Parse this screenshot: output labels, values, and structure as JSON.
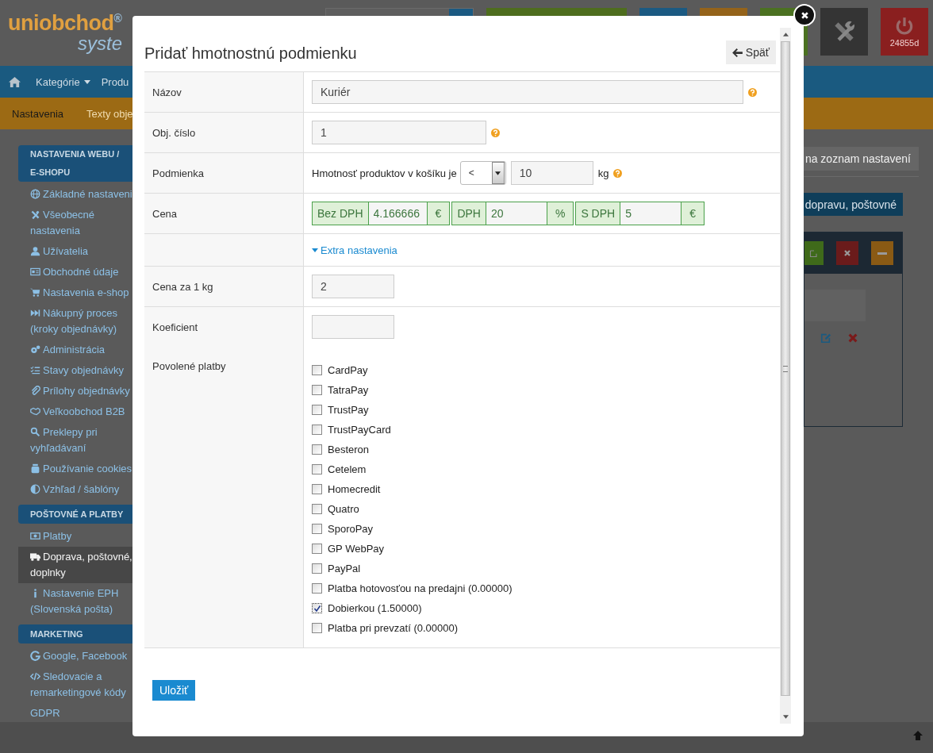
{
  "header": {
    "logo": {
      "text": "uniobchod",
      "mark": "®",
      "subtitle": "syste"
    },
    "toolbar": [
      {
        "kind": "search"
      },
      {
        "kind": "plain",
        "color": "#4e6d1e"
      },
      {
        "kind": "plain",
        "color": "#1b5a82"
      },
      {
        "kind": "plain",
        "color": "#94631a"
      },
      {
        "kind": "plain",
        "color": "#4b7121"
      },
      {
        "kind": "tools",
        "color": "#343434"
      },
      {
        "kind": "power",
        "color": "#8a1f1f",
        "badge": "24855d"
      }
    ]
  },
  "nav": [
    {
      "label": "Kategórie",
      "dropdown": true
    },
    {
      "label": "Produ",
      "dropdown": false
    }
  ],
  "subnav": [
    {
      "label": "Nastavenia",
      "selected": true
    },
    {
      "label": "Texty obje",
      "selected": false
    }
  ],
  "sidebar": [
    {
      "title": "NASTAVENIA WEBU / E-SHOPU",
      "items": [
        {
          "label": "Základné nastaveni",
          "selected": false
        },
        {
          "label": "Všeobecné nastavenia",
          "selected": false
        },
        {
          "label": "Užívatelia",
          "selected": false
        },
        {
          "label": "Obchodné údaje",
          "selected": false
        },
        {
          "label": "Nastavenia e-shop",
          "selected": false
        },
        {
          "label": "Nákupný proces (kroky objednávky)",
          "selected": false
        },
        {
          "label": "Administrácia",
          "selected": false
        },
        {
          "label": "Stavy objednávky",
          "selected": false
        },
        {
          "label": "Prílohy objednávky",
          "selected": false
        },
        {
          "label": "Veľkoobchod B2B",
          "selected": false
        },
        {
          "label": "Preklepy pri vyhľadávaní",
          "selected": false
        },
        {
          "label": "Používanie cookies",
          "selected": false
        },
        {
          "label": "Vzhľad / šablóny",
          "selected": false
        }
      ]
    },
    {
      "title": "POŠTOVNÉ A PLATBY",
      "items": [
        {
          "label": "Platby",
          "selected": false
        },
        {
          "label": "Doprava, poštovné, doplnky",
          "selected": true
        },
        {
          "label": "Nastavenie EPH (Slovenská pošta)",
          "selected": false
        }
      ]
    },
    {
      "title": "MARKETING",
      "items": [
        {
          "label": "Google, Facebook",
          "selected": false
        },
        {
          "label": "Sledovacie a remarketingové kódy",
          "selected": false
        },
        {
          "label": "GDPR",
          "selected": false
        }
      ]
    }
  ],
  "content": {
    "back_link": "na zoznam nastavení",
    "add_button": "dopravu, poštovné"
  },
  "modal": {
    "title": "Pridať hmotnostnú podmienku",
    "back_button": "Späť",
    "rows": [
      {
        "kind": "wide",
        "label": "Názov",
        "value": "Kuriér",
        "help": true
      },
      {
        "kind": "medium",
        "label": "Obj. číslo",
        "value": "1",
        "help": true
      },
      {
        "kind": "condition",
        "label": "Podmienka",
        "prefix": "Hmotnosť produktov v košíku je",
        "operator": "<",
        "value": "10",
        "unit": "kg",
        "help": true
      },
      {
        "kind": "price",
        "label": "Cena",
        "parts": [
          {
            "addon": "Bez DPH",
            "value": "4.166666",
            "suffix": "€"
          },
          {
            "addon": "DPH",
            "value": "20",
            "suffix": "%"
          },
          {
            "addon": "S DPH",
            "value": "5",
            "suffix": "€"
          }
        ]
      },
      {
        "kind": "link",
        "link": "Extra nastavenia"
      },
      {
        "kind": "small",
        "label": "Cena za 1 kg",
        "value": "2",
        "help": false
      },
      {
        "kind": "small",
        "label": "Koeficient",
        "help": false
      },
      {
        "kind": "checklist",
        "label": "Povolené platby",
        "options": [
          {
            "label": "CardPay",
            "checked": false
          },
          {
            "label": "TatraPay",
            "checked": false
          },
          {
            "label": "TrustPay",
            "checked": false
          },
          {
            "label": "TrustPayCard",
            "checked": false
          },
          {
            "label": "Besteron",
            "checked": false
          },
          {
            "label": "Cetelem",
            "checked": false
          },
          {
            "label": "Homecredit",
            "checked": false
          },
          {
            "label": "Quatro",
            "checked": false
          },
          {
            "label": "SporoPay",
            "checked": false
          },
          {
            "label": "GP WebPay",
            "checked": false
          },
          {
            "label": "PayPal",
            "checked": false
          },
          {
            "label": "Platba hotovosťou na predajni (0.00000)",
            "checked": false
          },
          {
            "label": "Dobierkou (1.50000)",
            "checked": true
          },
          {
            "label": "Platba pri prevzatí (0.00000)",
            "checked": false
          }
        ]
      }
    ],
    "save_button": "Uložiť"
  }
}
